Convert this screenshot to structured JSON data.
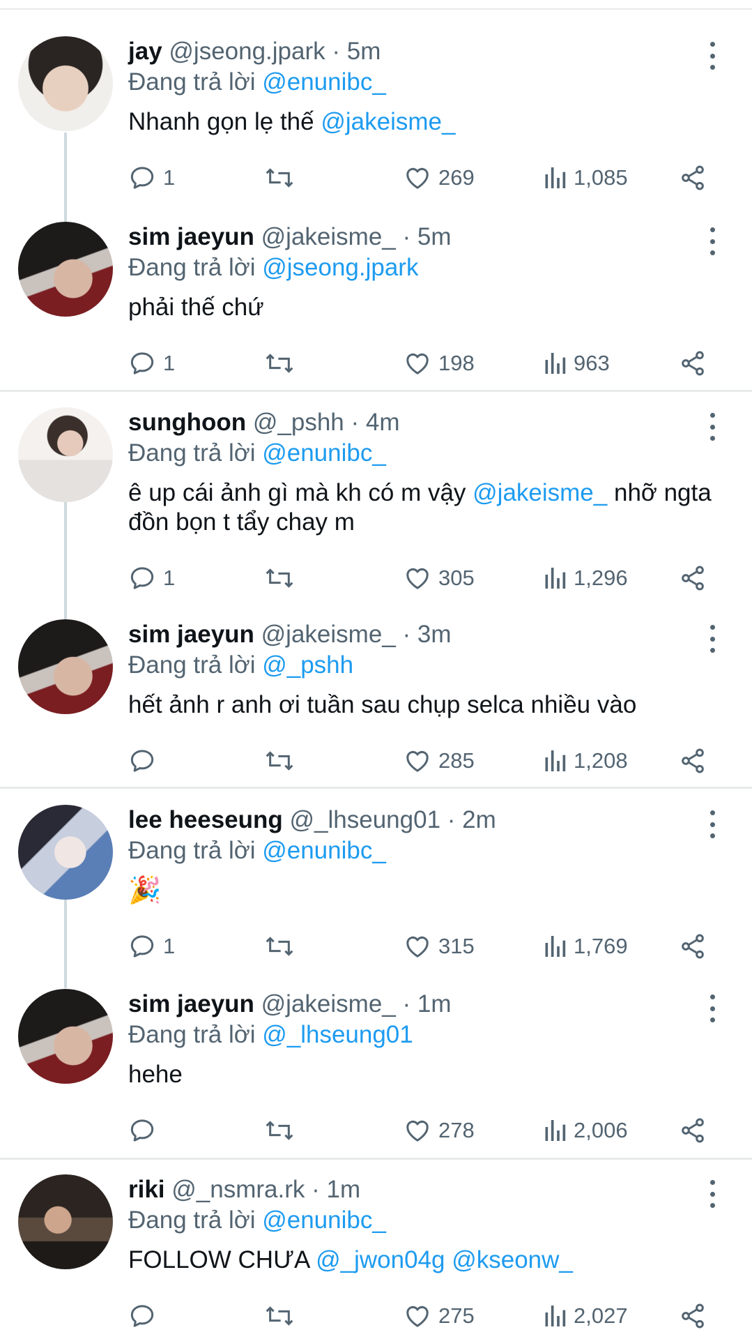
{
  "reply_prefix": "Đang trả lời",
  "tweets": [
    {
      "name": "jay",
      "handle": "@jseong.jpark",
      "time": "5m",
      "reply_to": "@enunibc_",
      "text": "Nhanh gọn lẹ thế ",
      "text_mention": "@jakeisme_",
      "text_after": "",
      "text2": "",
      "replies": "1",
      "likes": "269",
      "views": "1,085"
    },
    {
      "name": "sim jaeyun",
      "handle": "@jakeisme_",
      "time": "5m",
      "reply_to": "@jseong.jpark",
      "text": "phải thế chứ",
      "text_mention": "",
      "text_after": "",
      "text2": "",
      "replies": "1",
      "likes": "198",
      "views": "963"
    },
    {
      "name": "sunghoon",
      "handle": "@_pshh",
      "time": "4m",
      "reply_to": "@enunibc_",
      "text": "ê up cái ảnh gì mà kh có m vậy ",
      "text_mention": "@jakeisme_",
      "text_after": " nhỡ ngta đồn bọn t tẩy chay m",
      "text2": "",
      "replies": "1",
      "likes": "305",
      "views": "1,296"
    },
    {
      "name": "sim jaeyun",
      "handle": "@jakeisme_",
      "time": "3m",
      "reply_to": "@_pshh",
      "text": "hết ảnh r anh ơi tuần sau chụp selca nhiều vào",
      "text_mention": "",
      "text_after": "",
      "text2": "",
      "replies": "",
      "likes": "285",
      "views": "1,208"
    },
    {
      "name": "lee heeseung",
      "handle": "@_lhseung01",
      "time": "2m",
      "reply_to": "@enunibc_",
      "text": "🎉",
      "text_mention": "",
      "text_after": "",
      "text2": "",
      "replies": "1",
      "likes": "315",
      "views": "1,769"
    },
    {
      "name": "sim jaeyun",
      "handle": "@jakeisme_",
      "time": "1m",
      "reply_to": "@_lhseung01",
      "text": "hehe",
      "text_mention": "",
      "text_after": "",
      "text2": "",
      "replies": "",
      "likes": "278",
      "views": "2,006"
    },
    {
      "name": "riki",
      "handle": "@_nsmra.rk",
      "time": "1m",
      "reply_to": "@enunibc_",
      "text": "FOLLOW CHƯA ",
      "text_mention": "@_jwon04g",
      "text_after": " ",
      "text2": "@kseonw_",
      "replies": "",
      "likes": "275",
      "views": "2,027"
    }
  ],
  "icons": {
    "reply": "speech-bubble-icon",
    "retweet": "retweet-arrows-icon",
    "like": "heart-icon",
    "views": "bar-chart-icon",
    "share": "share-nodes-icon",
    "more": "vertical-dots-icon"
  },
  "colors": {
    "mention": "#1d9bf0",
    "secondary": "#536471",
    "divider": "#e7e9ea",
    "thread": "#cfd9de"
  }
}
